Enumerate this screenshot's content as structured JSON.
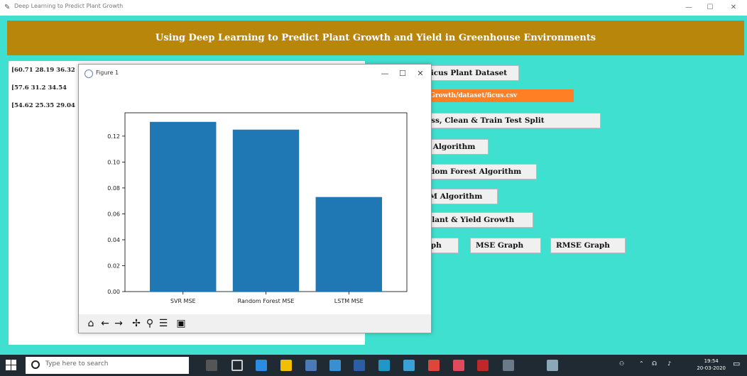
{
  "window": {
    "title": "Deep Learning to Predict Plant Growth",
    "minimize": "—",
    "maximize": "☐",
    "close": "✕"
  },
  "header": {
    "title": "Using Deep Learning to Predict Plant Growth and Yield in Greenhouse Environments"
  },
  "output": {
    "lines": [
      "[60.71 28.19 36.32",
      "[57.6  31.2  34.54",
      "[54.62 25.35 29.04"
    ]
  },
  "buttons": {
    "upload": "Upload Ficus Plant Dataset",
    "dataset_path": "E:/PlantGrowth/dataset/ficus.csv",
    "preprocess": "Preprocess, Clean & Train Test Split",
    "svr": "Run SVR Algorithm",
    "random_forest": "Run Random Forest Algorithm",
    "lstm": "Run LSTM Algorithm",
    "predict": "Predict Plant & Yield Growth",
    "mae_graph": "MAE Graph",
    "mse_graph": "MSE Graph",
    "rmse_graph": "RMSE Graph"
  },
  "figure": {
    "title": "Figure 1",
    "minimize": "—",
    "maximize": "☐",
    "close": "✕"
  },
  "chart_data": {
    "type": "bar",
    "categories": [
      "SVR MSE",
      "Random Forest MSE",
      "LSTM MSE"
    ],
    "values": [
      0.131,
      0.125,
      0.073
    ],
    "yticks": [
      "0.00",
      "0.02",
      "0.04",
      "0.06",
      "0.08",
      "0.10",
      "0.12"
    ],
    "ylim": [
      0,
      0.138
    ],
    "bar_color": "#1f77b4",
    "title": "",
    "xlabel": "",
    "ylabel": ""
  },
  "toolbar": {
    "home_icon": "home-icon",
    "back_icon": "back-arrow-icon",
    "forward_icon": "forward-arrow-icon",
    "pan_icon": "pan-icon",
    "zoom_icon": "zoom-icon",
    "configure_icon": "configure-icon",
    "save_icon": "save-icon"
  },
  "taskbar": {
    "search_placeholder": "Type here to search",
    "time": "19:54",
    "date": "20-03-2020"
  },
  "colors": {
    "background": "#40e0d0",
    "header": "#b8860b",
    "path_label": "#ff7f24",
    "bar": "#1f77b4"
  }
}
